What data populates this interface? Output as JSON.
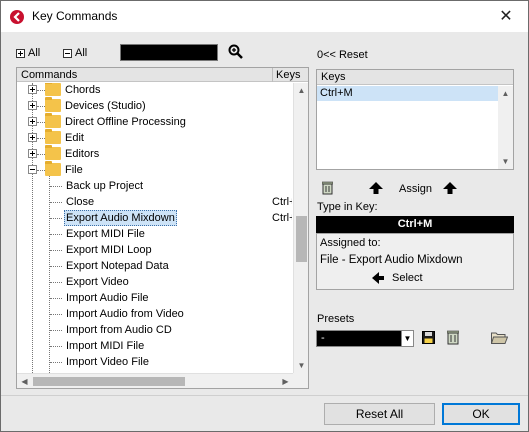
{
  "window": {
    "title": "Key Commands",
    "close_glyph": "✕"
  },
  "toolbar": {
    "expand_all_label": "All",
    "collapse_all_label": "All",
    "search_value": ""
  },
  "tree": {
    "header_commands": "Commands",
    "header_keys": "Keys",
    "rows": [
      {
        "label": "Chords",
        "type": "folder",
        "expanded": false,
        "key": ""
      },
      {
        "label": "Devices (Studio)",
        "type": "folder",
        "expanded": false,
        "key": ""
      },
      {
        "label": "Direct Offline Processing",
        "type": "folder",
        "expanded": false,
        "key": ""
      },
      {
        "label": "Edit",
        "type": "folder",
        "expanded": false,
        "key": ""
      },
      {
        "label": "Editors",
        "type": "folder",
        "expanded": false,
        "key": ""
      },
      {
        "label": "File",
        "type": "folder",
        "expanded": true,
        "key": ""
      },
      {
        "label": "Back up Project",
        "type": "item",
        "key": ""
      },
      {
        "label": "Close",
        "type": "item",
        "key": "Ctrl+"
      },
      {
        "label": "Export Audio Mixdown",
        "type": "item",
        "key": "Ctrl+",
        "selected": true
      },
      {
        "label": "Export MIDI File",
        "type": "item",
        "key": ""
      },
      {
        "label": "Export MIDI Loop",
        "type": "item",
        "key": ""
      },
      {
        "label": "Export Notepad Data",
        "type": "item",
        "key": ""
      },
      {
        "label": "Export Video",
        "type": "item",
        "key": ""
      },
      {
        "label": "Import Audio File",
        "type": "item",
        "key": ""
      },
      {
        "label": "Import Audio from Video",
        "type": "item",
        "key": ""
      },
      {
        "label": "Import from Audio CD",
        "type": "item",
        "key": ""
      },
      {
        "label": "Import MIDI File",
        "type": "item",
        "key": ""
      },
      {
        "label": "Import Video File",
        "type": "item",
        "key": ""
      }
    ]
  },
  "right": {
    "reset_prefix": "0<<",
    "reset_label": "Reset",
    "keys_header": "Keys",
    "keys_items": [
      "Ctrl+M"
    ],
    "assign_label": "Assign",
    "type_in_key_label": "Type in Key:",
    "type_in_key_value": "Ctrl+M",
    "assigned_to_label": "Assigned to:",
    "assigned_to_value": "File - Export Audio Mixdown",
    "select_label": "Select",
    "presets_label": "Presets",
    "presets_value": "-"
  },
  "buttons": {
    "reset_all": "Reset All",
    "ok": "OK"
  },
  "colors": {
    "selection": "#cde3f7",
    "folder": "#f4c34a",
    "ok_border": "#0078d7"
  }
}
